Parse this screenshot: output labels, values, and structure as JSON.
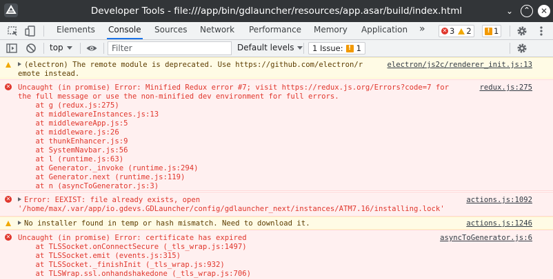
{
  "window": {
    "title": "Developer Tools - file:///app/bin/gdlauncher/resources/app.asar/build/index.html",
    "minimize_glyph": "⌄",
    "maximize_glyph": "⌃",
    "close_glyph": "✕"
  },
  "tabs": [
    {
      "label": "Elements"
    },
    {
      "label": "Console",
      "active": true
    },
    {
      "label": "Sources"
    },
    {
      "label": "Network"
    },
    {
      "label": "Performance"
    },
    {
      "label": "Memory"
    },
    {
      "label": "Application"
    }
  ],
  "more_tabs_glyph": "»",
  "counters": {
    "errors": "3",
    "warnings": "2",
    "issues": "1"
  },
  "console_toolbar": {
    "context": "top",
    "filter_placeholder": "Filter",
    "levels": "Default levels",
    "issue_label": "1 Issue:",
    "issue_count": "1"
  },
  "messages": [
    {
      "level": "warning",
      "lines": [
        "(electron) The remote module is deprecated. Use https://github.com/electron/r",
        "emote instead."
      ],
      "source": "electron/js2c/renderer_init.js:13"
    },
    {
      "level": "error",
      "lines": [
        "Uncaught (in promise) Error: Minified Redux error #7; visit https://redux.js.org/Errors?code=7 for",
        "the full message or use the non-minified dev environment for full errors.",
        "    at g (redux.js:275)",
        "    at middlewareInstances.js:13",
        "    at middlewareApp.js:5",
        "    at middleware.js:26",
        "    at thunkEnhancer.js:9",
        "    at SystemNavbar.js:56",
        "    at l (runtime.js:63)",
        "    at Generator._invoke (runtime.js:294)",
        "    at Generator.next (runtime.js:119)",
        "    at n (asyncToGenerator.js:3)"
      ],
      "source": "redux.js:275"
    },
    {
      "level": "error",
      "lines": [
        "Error: EEXIST: file already exists, open",
        "'/home/max/.var/app/io.gdevs.GDLauncher/config/gdlauncher_next/instances/ATM7.16/installing.lock'"
      ],
      "source": "actions.js:1092"
    },
    {
      "level": "warning",
      "lines": [
        "No installer found in temp or hash mismatch. Need to download it."
      ],
      "source": "actions.js:1246"
    },
    {
      "level": "error",
      "lines": [
        "Uncaught (in promise) Error: certificate has expired",
        "    at TLSSocket.onConnectSecure (_tls_wrap.js:1497)",
        "    at TLSSocket.emit (events.js:315)",
        "    at TLSSocket._finishInit (_tls_wrap.js:932)",
        "    at TLSWrap.ssl.onhandshakedone (_tls_wrap.js:706)"
      ],
      "source": "asyncToGenerator.js:6"
    }
  ]
}
